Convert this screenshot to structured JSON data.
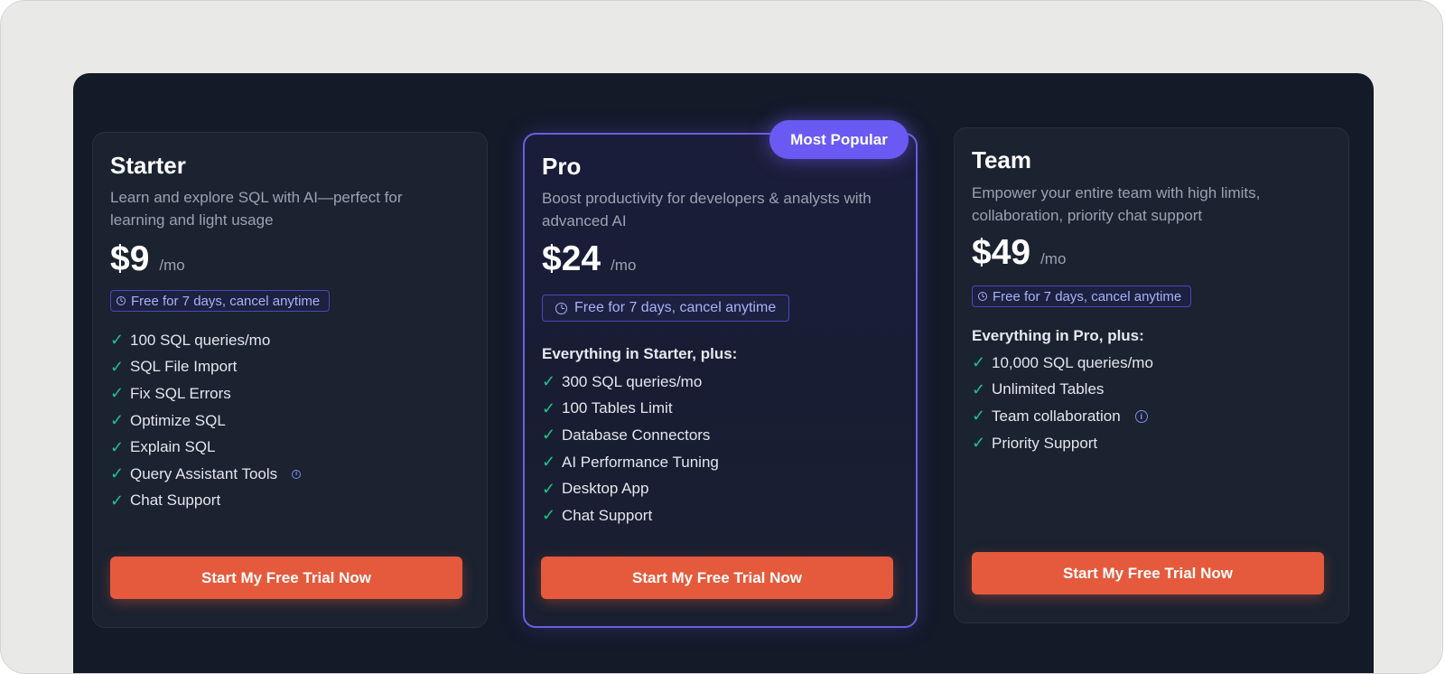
{
  "badge": "Most Popular",
  "plans": [
    {
      "name": "Starter",
      "description": "Learn and explore SQL with AI—perfect for learning and light usage",
      "price": "$9",
      "period": "/mo",
      "trial_note": "Free for 7 days, cancel anytime",
      "subheading": "",
      "features": [
        "100 SQL queries/mo",
        "SQL File Import",
        "Fix SQL Errors",
        "Optimize SQL",
        "Explain SQL",
        "Query Assistant Tools",
        "Chat Support"
      ],
      "cta": "Start My Free Trial Now"
    },
    {
      "name": "Pro",
      "description": "Boost productivity for developers & analysts with advanced AI",
      "price": "$24",
      "period": "/mo",
      "trial_note": "Free for 7 days, cancel anytime",
      "subheading": "Everything in Starter, plus:",
      "features": [
        "300 SQL queries/mo",
        "100 Tables Limit",
        "Database Connectors",
        "AI Performance Tuning",
        "Desktop App",
        "Chat Support"
      ],
      "cta": "Start My Free Trial Now"
    },
    {
      "name": "Team",
      "description": "Empower your entire team with high limits, collaboration, priority chat support",
      "price": "$49",
      "period": "/mo",
      "trial_note": "Free for 7 days, cancel anytime",
      "subheading": "Everything in Pro, plus:",
      "features": [
        "10,000 SQL queries/mo",
        "Unlimited Tables",
        "Team collaboration",
        "Priority Support"
      ],
      "cta": "Start My Free Trial Now"
    }
  ],
  "icons": {
    "check": "check-icon",
    "info": "info-icon",
    "clock": "clock-icon"
  },
  "colors": {
    "panel_bg": "#131a28",
    "card_bg": "#1b2230",
    "accent_purple": "#6a5af4",
    "cta_orange": "#e55a3c",
    "check_green": "#22c08a"
  }
}
